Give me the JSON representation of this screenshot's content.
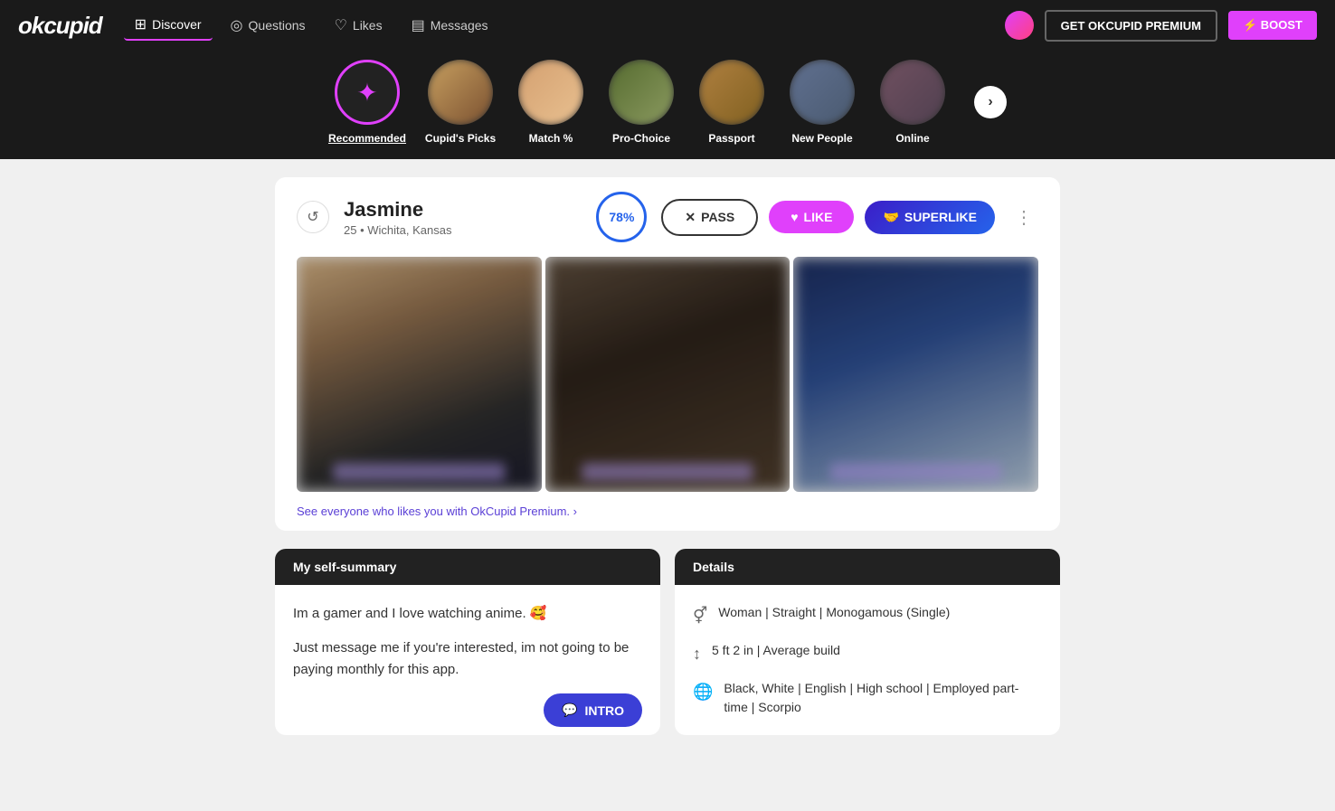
{
  "brand": {
    "name": "okcupid",
    "highlight_char": "ok"
  },
  "navbar": {
    "links": [
      {
        "id": "discover",
        "label": "Discover",
        "icon": "⊞",
        "active": true
      },
      {
        "id": "questions",
        "label": "Questions",
        "icon": "◎"
      },
      {
        "id": "likes",
        "label": "Likes",
        "icon": "♡"
      },
      {
        "id": "messages",
        "label": "Messages",
        "icon": "▤"
      }
    ],
    "btn_premium": "GET OKCUPID PREMIUM",
    "btn_boost": "⚡ BOOST"
  },
  "categories": [
    {
      "id": "recommended",
      "label": "Recommended",
      "active": true,
      "icon": "✦",
      "has_photo": false
    },
    {
      "id": "cupids_picks",
      "label": "Cupid's Picks",
      "active": false,
      "has_photo": true
    },
    {
      "id": "match",
      "label": "Match %",
      "active": false,
      "has_photo": true
    },
    {
      "id": "pro_choice",
      "label": "Pro-Choice",
      "active": false,
      "has_photo": true
    },
    {
      "id": "passport",
      "label": "Passport",
      "active": false,
      "has_photo": true
    },
    {
      "id": "new_people",
      "label": "New People",
      "active": false,
      "has_photo": true
    },
    {
      "id": "online",
      "label": "Online",
      "active": false,
      "has_photo": true
    }
  ],
  "profile": {
    "name": "Jasmine",
    "age": 25,
    "location": "Wichita, Kansas",
    "match_pct": "78%",
    "buttons": {
      "pass": "PASS",
      "like": "LIKE",
      "superlike": "SUPERLIKE"
    },
    "premium_prompt": "See everyone who likes you with OkCupid Premium. ›",
    "self_summary": {
      "header": "My self-summary",
      "text1": "Im a gamer and I love watching anime. 🥰",
      "text2": "Just message me if you're interested, im not going to be paying monthly for this app.",
      "btn_intro": "INTRO"
    },
    "details": {
      "header": "Details",
      "items": [
        {
          "icon": "⚥",
          "text": "Woman | Straight | Monogamous (Single)"
        },
        {
          "icon": "↕",
          "text": "5 ft 2 in | Average build"
        },
        {
          "icon": "🌐",
          "text": "Black, White | English | High school | Employed part-time | Scorpio"
        }
      ]
    }
  }
}
